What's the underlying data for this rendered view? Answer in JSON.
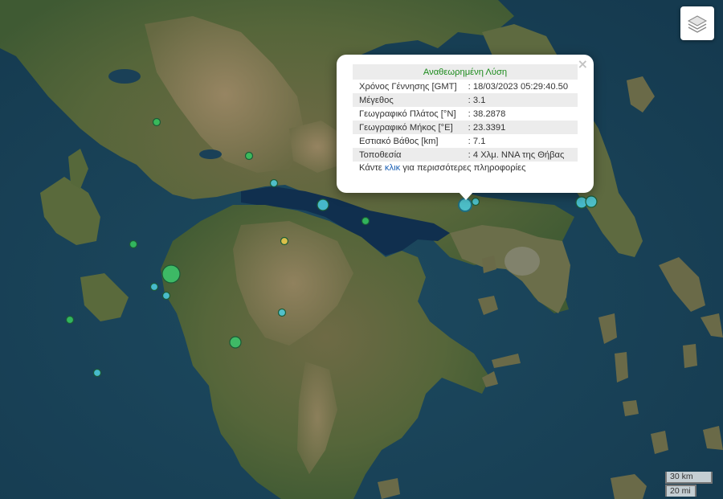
{
  "map": {
    "sea_color": "#183f52",
    "gulf_color": "#102f4e",
    "land_color": "#5a6a3a",
    "mountain_color": "#8a7a5a",
    "layers_icon": "layers-icon",
    "events": [
      {
        "id": "e1",
        "magnitude_class": "large",
        "color": "#3cc36a"
      },
      {
        "id": "e2",
        "magnitude_class": "medium",
        "color": "#3cc36a"
      },
      {
        "id": "e3",
        "magnitude_class": "small",
        "color": "#35c25e"
      },
      {
        "id": "e4",
        "magnitude_class": "small",
        "color": "#35c25e"
      },
      {
        "id": "e5",
        "magnitude_class": "small",
        "color": "#35c25e"
      },
      {
        "id": "e6",
        "magnitude_class": "small",
        "color": "#35c25e"
      },
      {
        "id": "e7",
        "magnitude_class": "small",
        "color": "#35c25e"
      },
      {
        "id": "e8",
        "magnitude_class": "small",
        "color": "#e6c84a"
      },
      {
        "id": "e9",
        "magnitude_class": "medium",
        "color": "#4cc8d8"
      },
      {
        "id": "e10",
        "magnitude_class": "medium-selected",
        "color": "#4cc8d8"
      },
      {
        "id": "e11",
        "magnitude_class": "small",
        "color": "#4cc8d8"
      },
      {
        "id": "e12",
        "magnitude_class": "small",
        "color": "#4cc8d8"
      },
      {
        "id": "e13",
        "magnitude_class": "small",
        "color": "#4cc8d8"
      },
      {
        "id": "e14",
        "magnitude_class": "small",
        "color": "#4cc8d8"
      },
      {
        "id": "e15",
        "magnitude_class": "small",
        "color": "#4cc8d8"
      },
      {
        "id": "e16",
        "magnitude_class": "small",
        "color": "#4cc8d8"
      },
      {
        "id": "e17",
        "magnitude_class": "medium",
        "color": "#4cc8d8"
      },
      {
        "id": "e18",
        "magnitude_class": "medium",
        "color": "#4cc8d8"
      }
    ]
  },
  "popup": {
    "header": "Αναθεωρημένη Λύση",
    "rows": [
      {
        "label": "Χρόνος Γέννησης [GMT]",
        "value": ": 18/03/2023 05:29:40.50"
      },
      {
        "label": "Μέγεθος",
        "value": ": 3.1"
      },
      {
        "label": "Γεωγραφικό Πλάτος [°N]",
        "value": ": 38.2878"
      },
      {
        "label": "Γεωγραφικό Μήκος [°E]",
        "value": ": 23.3391"
      },
      {
        "label": "Εστιακό Βάθος [km]",
        "value": ": 7.1"
      },
      {
        "label": "Τοποθεσία",
        "value": ": 4 Χλμ. ΝΝΑ της Θήβας"
      }
    ],
    "more_prefix": "Κάντε",
    "more_link": "κλικ",
    "more_suffix": "για περισσότερες πληροφορίες",
    "close": "×"
  },
  "scale": {
    "km": "30 km",
    "mi": "20 mi"
  }
}
